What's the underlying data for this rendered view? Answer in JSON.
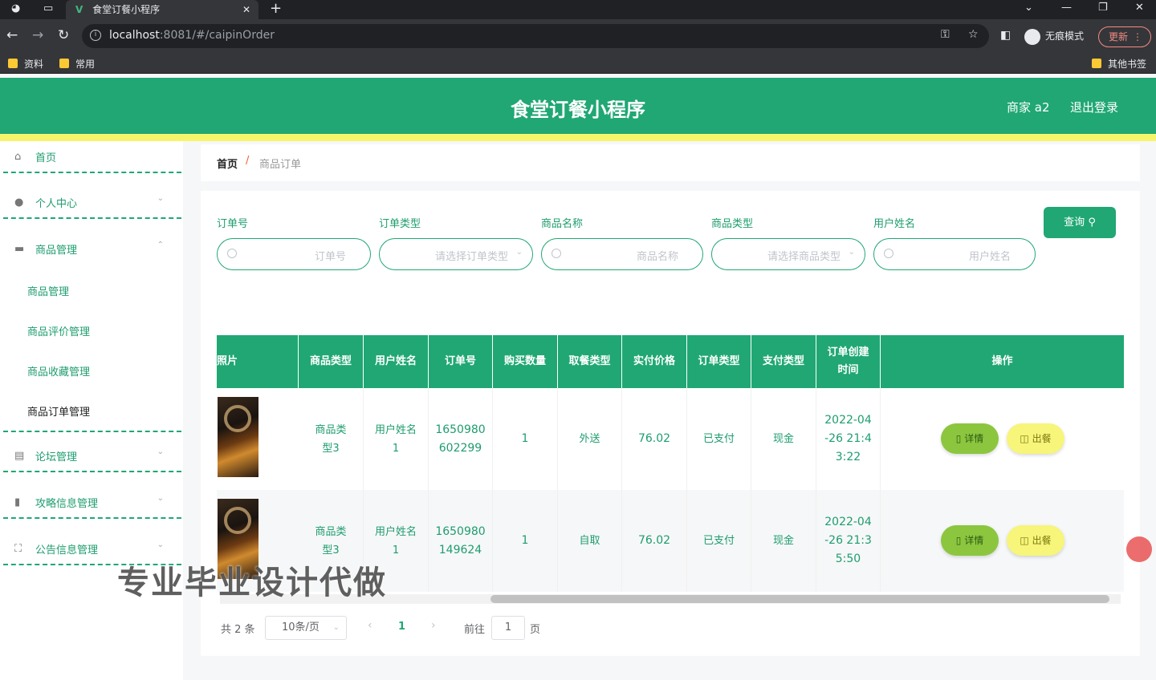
{
  "browser": {
    "tab_title": "食堂订餐小程序",
    "tab_logo": "V",
    "url_host": "localhost",
    "url_rest": ":8081/#/caipinOrder",
    "incognito_label": "无痕模式",
    "update_label": "更新",
    "bookmarks": [
      "资料",
      "常用"
    ],
    "other_bookmarks": "其他书签"
  },
  "header": {
    "title": "食堂订餐小程序",
    "user_label": "商家 a2",
    "logout_label": "退出登录"
  },
  "sidebar": {
    "items": [
      {
        "label": "首页",
        "icon": "home-icon"
      },
      {
        "label": "个人中心",
        "icon": "user-icon"
      },
      {
        "label": "商品管理",
        "icon": "briefcase-icon"
      },
      {
        "label": "论坛管理",
        "icon": "forum-icon"
      },
      {
        "label": "攻略信息管理",
        "icon": "clipboard-icon"
      },
      {
        "label": "公告信息管理",
        "icon": "frame-icon"
      }
    ],
    "sub_items": [
      "商品管理",
      "商品评价管理",
      "商品收藏管理",
      "商品订单管理"
    ]
  },
  "breadcrumb": {
    "home": "首页",
    "separator": "/",
    "current": "商品订单"
  },
  "search": {
    "fields": [
      {
        "label": "订单号",
        "placeholder": "订单号"
      },
      {
        "label": "订单类型",
        "placeholder": "请选择订单类型"
      },
      {
        "label": "商品名称",
        "placeholder": "商品名称"
      },
      {
        "label": "商品类型",
        "placeholder": "请选择商品类型"
      },
      {
        "label": "用户姓名",
        "placeholder": "用户姓名"
      }
    ],
    "query_label": "查询"
  },
  "table": {
    "headers": [
      "照片",
      "商品类型",
      "用户姓名",
      "订单号",
      "购买数量",
      "取餐类型",
      "实付价格",
      "订单类型",
      "支付类型",
      "订单创建时间",
      "操作"
    ],
    "rows": [
      {
        "type": "商品类型3",
        "user": "用户姓名1",
        "order": "1650980602299",
        "qty": "1",
        "pickup": "外送",
        "price": "76.02",
        "order_type": "已支付",
        "pay": "现金",
        "time": "2022-04-26 21:43:22"
      },
      {
        "type": "商品类型3",
        "user": "用户姓名1",
        "order": "1650980149624",
        "qty": "1",
        "pickup": "自取",
        "price": "76.02",
        "order_type": "已支付",
        "pay": "现金",
        "time": "2022-04-26 21:35:50"
      }
    ],
    "detail_label": "详情",
    "serve_label": "出餐"
  },
  "pagination": {
    "total": "共 2 条",
    "page_size": "10条/页",
    "current_page": "1",
    "goto_label": "前往",
    "goto_value": "1",
    "page_unit": "页"
  },
  "watermark": "专业毕业设计代做",
  "colors": {
    "primary": "#20a774",
    "accent_yellow": "#f6f56a",
    "detail_green": "#8cc63f"
  }
}
